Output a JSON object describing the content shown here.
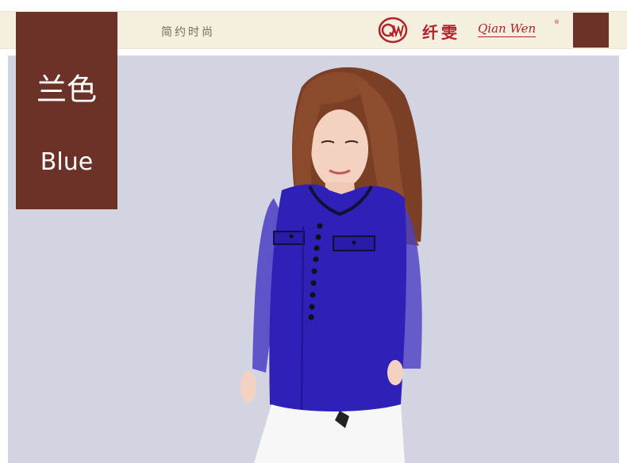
{
  "banner": {
    "slogan": "简约时尚",
    "brand_monogram": "QW",
    "brand_name_cn": "纤雯",
    "brand_name_en": "Qian Wen",
    "registered_mark": "®"
  },
  "color_tag": {
    "name_cn": "兰色",
    "name_en": "Blue"
  },
  "colors": {
    "tag_brown": "#6d3227",
    "banner_cream": "#f4efdf",
    "brand_red": "#b3202a",
    "photo_background": "#d3d4e1",
    "blouse_blue": "#2f20b8"
  }
}
